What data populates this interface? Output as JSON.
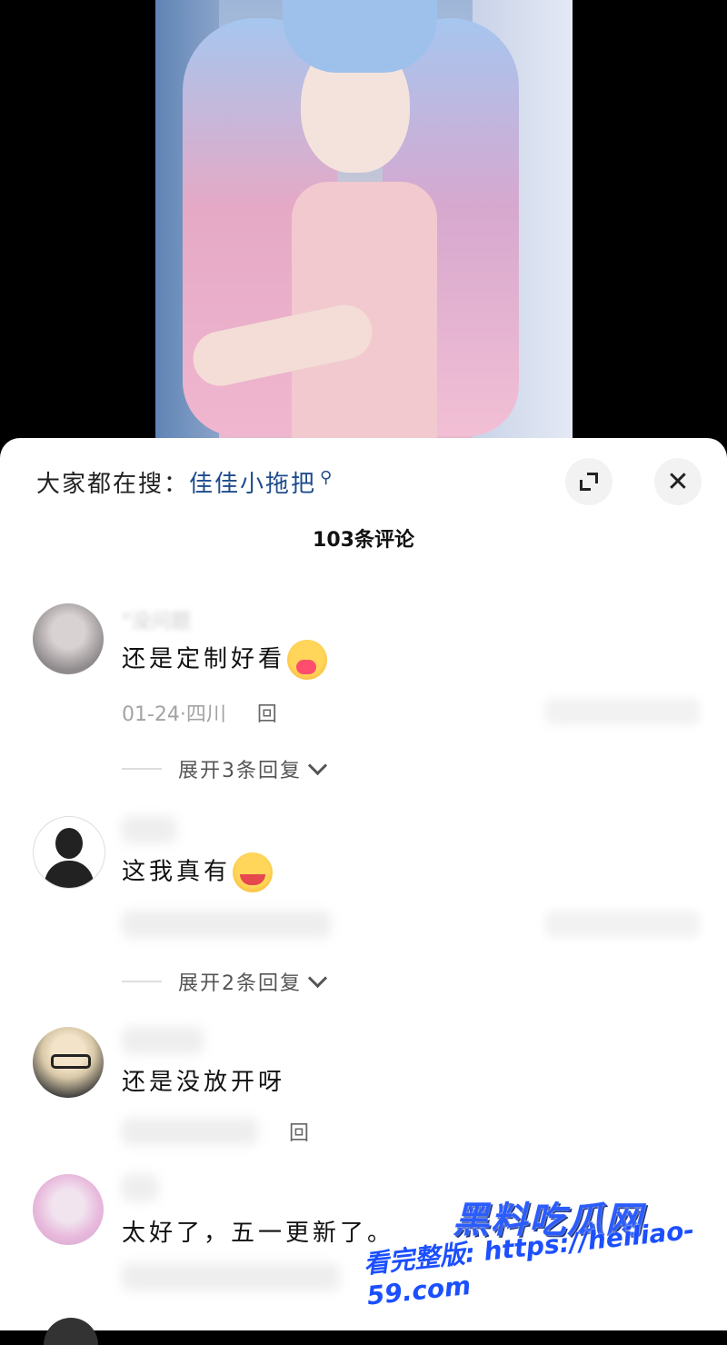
{
  "sheet": {
    "search_prefix": "大家都在搜：",
    "search_term": "佳佳小拖把",
    "comment_count": "103条评论"
  },
  "comments": [
    {
      "username": "\"没问题",
      "text": "还是定制好看",
      "emoji": "hugging-face-icon",
      "date_location": "01-24·四川",
      "reply_label": "回",
      "expand_label": "展开3条回复"
    },
    {
      "text": "这我真有",
      "emoji": "rolling-laughing-icon",
      "expand_label": "展开2条回复"
    },
    {
      "text": "还是没放开呀",
      "reply_label": "回"
    },
    {
      "text": "太好了，五一更新了。"
    }
  ],
  "watermark": {
    "logo": "黑料吃瓜网",
    "url": "看完整版: https://heiliao-59.com"
  },
  "colors": {
    "search_term": "#1e4c8c",
    "watermark": "#2a5cff"
  }
}
